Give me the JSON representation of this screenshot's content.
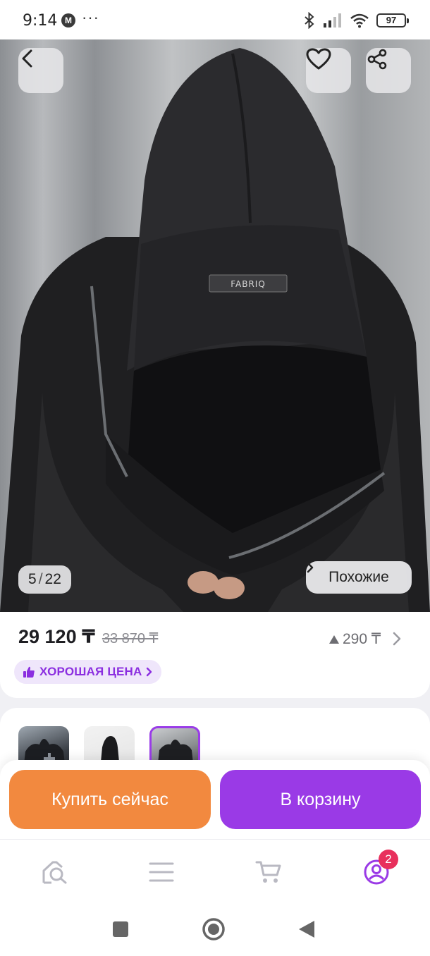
{
  "status_bar": {
    "time": "9:14",
    "app_icon_letter": "M",
    "more": "···",
    "battery": "97",
    "icons": [
      "bluetooth-icon",
      "signal-icon",
      "wifi-icon",
      "battery-icon"
    ]
  },
  "gallery": {
    "current": "5",
    "separator": "/",
    "total": "22",
    "similar_label": "Похожие",
    "label_text": "FABRIQ"
  },
  "price": {
    "current": "29 120 ₸",
    "old": "33 870 ₸",
    "delta": "290 ₸",
    "good_price_label": "ХОРОШАЯ ЦЕНА"
  },
  "actions": {
    "buy_now": "Купить сейчас",
    "add_to_cart": "В корзину"
  },
  "nav": {
    "profile_badge": "2",
    "items": [
      "home-icon",
      "catalog-icon",
      "cart-icon",
      "profile-icon"
    ]
  },
  "colors": {
    "accent_purple": "#9a3ae6",
    "accent_orange": "#f2893f",
    "badge_red": "#e8305c",
    "good_price_bg": "#efe6fb"
  }
}
